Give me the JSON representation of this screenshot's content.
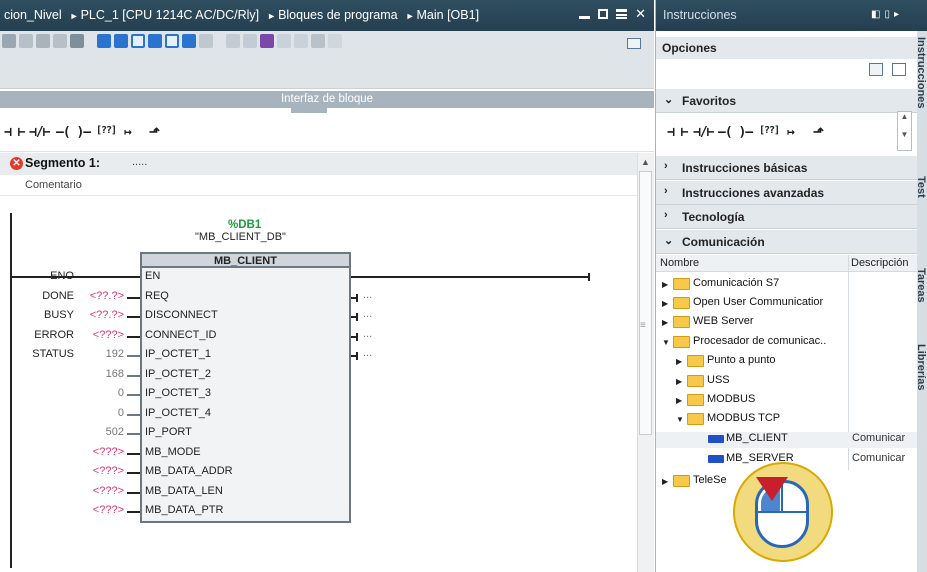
{
  "editor": {
    "breadcrumb": [
      "cion_Nivel",
      "PLC_1 [CPU 1214C AC/DC/Rly]",
      "Bloques de programa",
      "Main [OB1]"
    ],
    "breadcrumb_sep": "►",
    "close_glyph": "✕",
    "interface_bar": "Interfaz de bloque",
    "segment_title": "Segmento 1:",
    "segment_dots": ".....",
    "segment_comment": "Comentario",
    "error_glyph": "✕",
    "ladder_symbols": [
      "⊣ ⊢",
      "⊣/⊢",
      "–( )–",
      "[??]",
      "↦",
      "⬏"
    ],
    "db": {
      "name": "%DB1",
      "symbol": "\"MB_CLIENT_DB\""
    },
    "block": {
      "title": "MB_CLIENT",
      "inputs": [
        {
          "pin": "EN",
          "value": ""
        },
        {
          "pin": "REQ",
          "value": "<??.?>"
        },
        {
          "pin": "DISCONNECT",
          "value": "<??.?>"
        },
        {
          "pin": "CONNECT_ID",
          "value": "<???>"
        },
        {
          "pin": "IP_OCTET_1",
          "value": "192"
        },
        {
          "pin": "IP_OCTET_2",
          "value": "168"
        },
        {
          "pin": "IP_OCTET_3",
          "value": "0"
        },
        {
          "pin": "IP_OCTET_4",
          "value": "0"
        },
        {
          "pin": "IP_PORT",
          "value": "502"
        },
        {
          "pin": "MB_MODE",
          "value": "<???>"
        },
        {
          "pin": "MB_DATA_ADDR",
          "value": "<???>"
        },
        {
          "pin": "MB_DATA_LEN",
          "value": "<???>"
        },
        {
          "pin": "MB_DATA_PTR",
          "value": "<???>"
        }
      ],
      "outputs": [
        {
          "pin": "ENO",
          "value": ""
        },
        {
          "pin": "DONE",
          "value": "..."
        },
        {
          "pin": "BUSY",
          "value": "..."
        },
        {
          "pin": "ERROR",
          "value": "..."
        },
        {
          "pin": "STATUS",
          "value": "..."
        }
      ]
    }
  },
  "instructions": {
    "title": "Instrucciones",
    "options_label": "Opciones",
    "favorites_label": "Favoritos",
    "fav_symbols": [
      "⊣ ⊢",
      "⊣/⊢",
      "–( )–",
      "[??]",
      "↦",
      "⬏"
    ],
    "sections": [
      "Instrucciones básicas",
      "Instrucciones avanzadas",
      "Tecnología",
      "Comunicación"
    ],
    "table_headers": {
      "name": "Nombre",
      "description": "Descripción"
    },
    "tree": [
      {
        "label": "Comunicación S7",
        "level": 0
      },
      {
        "label": "Open User Communicatior",
        "level": 0
      },
      {
        "label": "WEB Server",
        "level": 0
      },
      {
        "label": "Procesador de comunicac..",
        "level": 0
      },
      {
        "label": "Punto a punto",
        "level": 1
      },
      {
        "label": "USS",
        "level": 1
      },
      {
        "label": "MODBUS",
        "level": 1
      },
      {
        "label": "MODBUS TCP",
        "level": 1
      },
      {
        "label": "MB_CLIENT",
        "level": 2,
        "description": "Comunicar"
      },
      {
        "label": "MB_SERVER",
        "level": 2,
        "description": "Comunicar"
      },
      {
        "label": "TeleSe",
        "level": 0
      }
    ],
    "side_tabs": [
      "Instrucciones",
      "Test",
      "Tareas",
      "Librerías"
    ]
  }
}
